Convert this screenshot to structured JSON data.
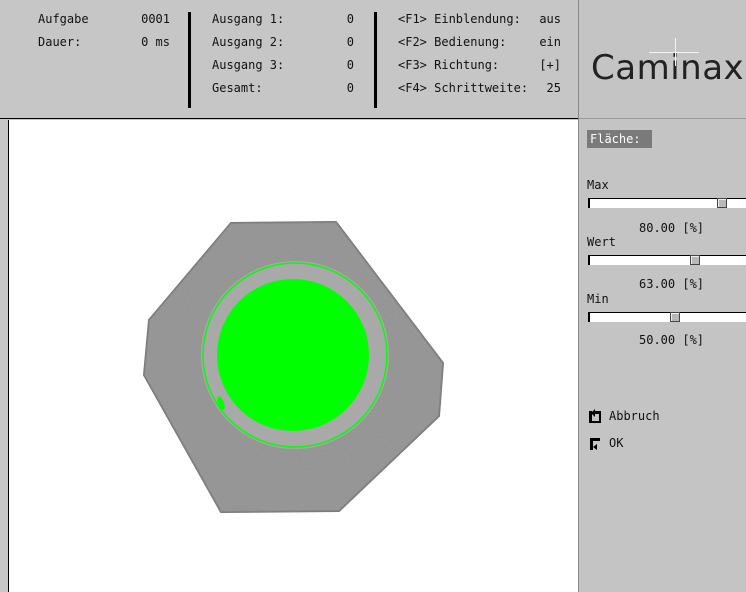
{
  "header": {
    "group1": [
      {
        "label": "Aufgabe",
        "value": "0001"
      },
      {
        "label": "Dauer:",
        "value": "0 ms"
      }
    ],
    "group2": [
      {
        "label": "Ausgang 1:",
        "value": "0"
      },
      {
        "label": "Ausgang 2:",
        "value": "0"
      },
      {
        "label": "Ausgang 3:",
        "value": "0"
      },
      {
        "label": "Gesamt:",
        "value": "0"
      }
    ],
    "group3": [
      {
        "label": "<F1> Einblendung:",
        "value": "aus"
      },
      {
        "label": "<F2> Bedienung:",
        "value": "ein"
      },
      {
        "label": "<F3> Richtung:",
        "value": "[+]"
      },
      {
        "label": "<F4> Schrittweite:",
        "value": "25"
      }
    ]
  },
  "logo": "Caminax",
  "panel": {
    "title": "Fläche:",
    "sliders": [
      {
        "label": "Max",
        "value_text": "80.00  [%]",
        "level_pct": 80
      },
      {
        "label": "Wert",
        "value_text": "63.00  [%]",
        "level_pct": 63
      },
      {
        "label": "Min",
        "value_text": "50.00  [%]",
        "level_pct": 50
      }
    ],
    "buttons": {
      "cancel": "Abbruch",
      "ok": "OK"
    }
  },
  "colors": {
    "highlight": "#00ff00",
    "part": "#8e8e8e",
    "background": "#ffffff"
  }
}
